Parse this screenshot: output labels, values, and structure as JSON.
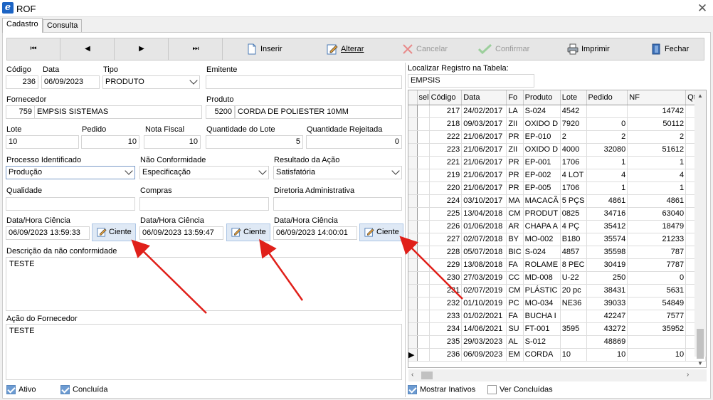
{
  "window": {
    "title": "ROF",
    "app_icon": "e-icon"
  },
  "tabs": [
    "Cadastro",
    "Consulta"
  ],
  "toolbar": {
    "first": "⏮",
    "prev": "◀",
    "next": "▶",
    "last": "⏭",
    "inserir": "Inserir",
    "alterar": "Alterar",
    "cancelar": "Cancelar",
    "confirmar": "Confirmar",
    "imprimir": "Imprimir",
    "fechar": "Fechar"
  },
  "form": {
    "codigo": {
      "label": "Código",
      "value": "236"
    },
    "data": {
      "label": "Data",
      "value": "06/09/2023"
    },
    "tipo": {
      "label": "Tipo",
      "value": "PRODUTO"
    },
    "emitente": {
      "label": "Emitente",
      "value": ""
    },
    "fornecedor": {
      "label": "Fornecedor",
      "code": "759",
      "name": "EMPSIS SISTEMAS"
    },
    "produto": {
      "label": "Produto",
      "code": "5200",
      "name": "CORDA DE POLIESTER 10MM"
    },
    "lote": {
      "label": "Lote",
      "value": "10"
    },
    "pedido": {
      "label": "Pedido",
      "value": "10"
    },
    "nota_fiscal": {
      "label": "Nota Fiscal",
      "value": "10"
    },
    "quantidade_lote": {
      "label": "Quantidade do Lote",
      "value": "5"
    },
    "quantidade_rejeitada": {
      "label": "Quantidade Rejeitada",
      "value": "0"
    },
    "processo": {
      "label": "Processo Identificado",
      "value": "Produção"
    },
    "nao_conformidade": {
      "label": "Não Conformidade",
      "value": "Especificação"
    },
    "resultado": {
      "label": "Resultado da Ação",
      "value": "Satisfatória"
    },
    "qualidade": {
      "label": "Qualidade",
      "value": ""
    },
    "compras": {
      "label": "Compras",
      "value": ""
    },
    "diretoria": {
      "label": "Diretoria Administrativa",
      "value": ""
    },
    "ciencia1": {
      "label": "Data/Hora Ciência",
      "value": "06/09/2023 13:59:33"
    },
    "ciencia2": {
      "label": "Data/Hora Ciência",
      "value": "06/09/2023 13:59:47"
    },
    "ciencia3": {
      "label": "Data/Hora Ciência",
      "value": "06/09/2023 14:00:01"
    },
    "ciente_label": "Ciente",
    "descricao": {
      "label": "Descrição da não conformidade",
      "value": "TESTE"
    },
    "acao_fornecedor": {
      "label": "Ação do Fornecedor",
      "value": "TESTE"
    },
    "ativo": {
      "label": "Ativo",
      "checked": true
    },
    "concluida": {
      "label": "Concluída",
      "checked": true
    }
  },
  "search": {
    "label": "Localizar Registro na Tabela:",
    "value": "EMPSIS"
  },
  "table": {
    "columns": [
      "sel",
      "Código",
      "Data",
      "Fo",
      "Produto",
      "Lote",
      "Pedido",
      "NF",
      "Qtd"
    ],
    "rows": [
      [
        "",
        "217",
        "24/02/2017",
        "LA",
        "S-024",
        "4542",
        "",
        "14742",
        ""
      ],
      [
        "",
        "218",
        "09/03/2017",
        "ZII",
        "OXIDO D",
        "7920",
        "0",
        "50112",
        ""
      ],
      [
        "",
        "222",
        "21/06/2017",
        "PR",
        "EP-010",
        "2",
        "2",
        "2",
        ""
      ],
      [
        "",
        "223",
        "21/06/2017",
        "ZII",
        "OXIDO D",
        "4000",
        "32080",
        "51612",
        ""
      ],
      [
        "",
        "221",
        "21/06/2017",
        "PR",
        "EP-001",
        "1706",
        "1",
        "1",
        ""
      ],
      [
        "",
        "219",
        "21/06/2017",
        "PR",
        "EP-002",
        "4 LOT",
        "4",
        "4",
        ""
      ],
      [
        "",
        "220",
        "21/06/2017",
        "PR",
        "EP-005",
        "1706",
        "1",
        "1",
        ""
      ],
      [
        "",
        "224",
        "03/10/2017",
        "MA",
        "MACACÃ",
        "5 PÇS",
        "4861",
        "4861",
        ""
      ],
      [
        "",
        "225",
        "13/04/2018",
        "CM",
        "PRODUT",
        "0825",
        "34716",
        "63040",
        ""
      ],
      [
        "",
        "226",
        "01/06/2018",
        "AR",
        "CHAPA A",
        "4 PÇ",
        "35412",
        "18479",
        ""
      ],
      [
        "",
        "227",
        "02/07/2018",
        "BY",
        "MO-002",
        "B180",
        "35574",
        "21233",
        ""
      ],
      [
        "",
        "228",
        "05/07/2018",
        "BIC",
        "S-024",
        "4857",
        "35598",
        "787",
        ""
      ],
      [
        "",
        "229",
        "13/08/2018",
        "FA",
        "ROLAME",
        "8 PEC",
        "30419",
        "7787",
        ""
      ],
      [
        "",
        "230",
        "27/03/2019",
        "CC",
        "MD-008",
        "U-22",
        "250",
        "0",
        ""
      ],
      [
        "",
        "231",
        "02/07/2019",
        "CM",
        "PLÁSTIC",
        "20 pc",
        "38431",
        "5631",
        ""
      ],
      [
        "",
        "232",
        "01/10/2019",
        "PC",
        "MO-034",
        "NE36",
        "39033",
        "54849",
        ""
      ],
      [
        "",
        "233",
        "01/02/2021",
        "FA",
        "BUCHA I",
        "",
        "42247",
        "7577",
        ""
      ],
      [
        "",
        "234",
        "14/06/2021",
        "SU",
        "FT-001",
        "3595",
        "43272",
        "35952",
        ""
      ],
      [
        "",
        "235",
        "29/03/2023",
        "AL",
        "S-012",
        "",
        "48869",
        "",
        ""
      ],
      [
        "▶",
        "236",
        "06/09/2023",
        "EM",
        "CORDA",
        "10",
        "10",
        "10",
        ""
      ]
    ]
  },
  "footer": {
    "mostrar_inativos": {
      "label": "Mostrar Inativos",
      "checked": true
    },
    "ver_concluidas": {
      "label": "Ver Concluídas",
      "checked": false
    }
  },
  "colors": {
    "accent": "#1c64c4",
    "arrow": "#e0201a"
  }
}
